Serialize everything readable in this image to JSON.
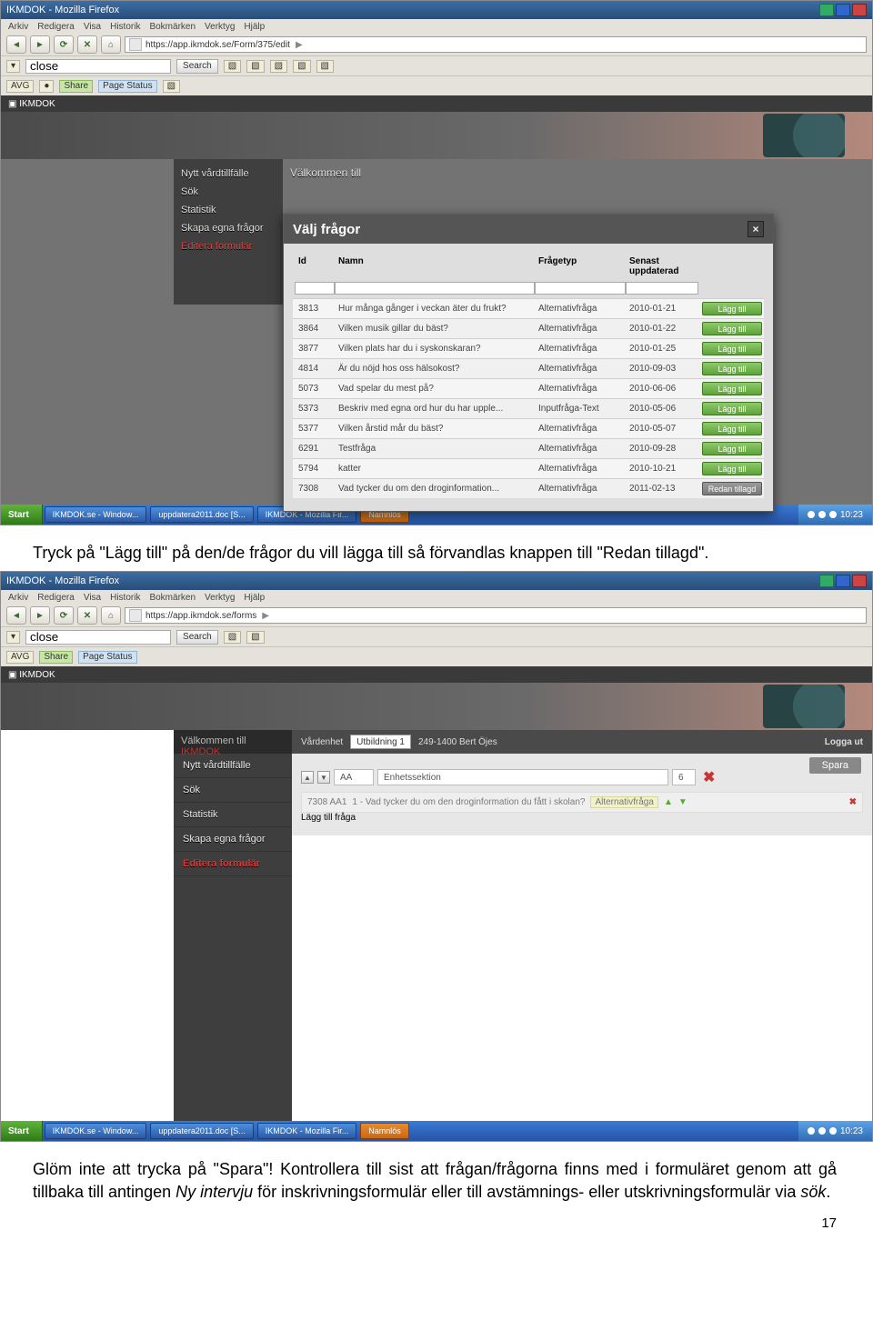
{
  "browser": {
    "title": "IKMDOK - Mozilla Firefox",
    "menu": [
      "Arkiv",
      "Redigera",
      "Visa",
      "Historik",
      "Bokmärken",
      "Verktyg",
      "Hjälp"
    ],
    "url1": "https://app.ikmdok.se/Form/375/edit",
    "url2": "https://app.ikmdok.se/forms",
    "search_placeholder": "close",
    "search_btn": "Search",
    "toolbar_labels": {
      "avg": "AVG",
      "pin": "",
      "share": "Share",
      "pagestatus": "Page Status"
    }
  },
  "app1": {
    "welcome_prefix": "Välkommen till",
    "sidebar": [
      "Nytt vårdtillfälle",
      "Sök",
      "Statistik",
      "Skapa egna frågor",
      "Editera formulär"
    ],
    "dialog_title": "Välj frågor",
    "columns": {
      "id": "Id",
      "name": "Namn",
      "type": "Frågetyp",
      "date": "Senast uppdaterad"
    },
    "add_label": "Lägg till",
    "added_label": "Redan tillagd",
    "rows": [
      {
        "id": "3813",
        "name": "Hur många gånger i veckan äter du frukt?",
        "type": "Alternativfråga",
        "date": "2010-01-21",
        "added": false
      },
      {
        "id": "3864",
        "name": "Vilken musik gillar du bäst?",
        "type": "Alternativfråga",
        "date": "2010-01-22",
        "added": false
      },
      {
        "id": "3877",
        "name": "Vilken plats har du i syskonskaran?",
        "type": "Alternativfråga",
        "date": "2010-01-25",
        "added": false
      },
      {
        "id": "4814",
        "name": "Är du nöjd hos oss hälsokost?",
        "type": "Alternativfråga",
        "date": "2010-09-03",
        "added": false
      },
      {
        "id": "5073",
        "name": "Vad spelar du mest på?",
        "type": "Alternativfråga",
        "date": "2010-06-06",
        "added": false
      },
      {
        "id": "5373",
        "name": "Beskriv med egna ord hur du har upple...",
        "type": "Inputfråga-Text",
        "date": "2010-05-06",
        "added": false
      },
      {
        "id": "5377",
        "name": "Vilken årstid mår du bäst?",
        "type": "Alternativfråga",
        "date": "2010-05-07",
        "added": false
      },
      {
        "id": "6291",
        "name": "Testfråga",
        "type": "Alternativfråga",
        "date": "2010-09-28",
        "added": false
      },
      {
        "id": "5794",
        "name": "katter",
        "type": "Alternativfråga",
        "date": "2010-10-21",
        "added": false
      },
      {
        "id": "7308",
        "name": "Vad tycker du om den droginformation...",
        "type": "Alternativfråga",
        "date": "2011-02-13",
        "added": true
      }
    ]
  },
  "taskbar": {
    "start": "Start",
    "items": [
      "IKMDOK.se - Window...",
      "uppdatera2011.doc [S...",
      "IKMDOK - Mozilla Fir...",
      "Namnlös"
    ],
    "time": "10:23"
  },
  "para1_a": "Tryck på ",
  "para1_b": "Lägg till",
  "para1_c": " på den/de frågor du vill lägga till så förvandlas knappen till ",
  "para1_d": "Redan tillagd",
  "para1_e": ".",
  "app2": {
    "welcome_prefix": "Välkommen till",
    "welcome_brand": "IKMDOK",
    "header_items": {
      "vardkedja": "Vårdenhet",
      "utbildning": "Utbildning 1",
      "user": "249-1400 Bert Öjes"
    },
    "logout": "Logga ut",
    "save": "Spara",
    "sidebar": [
      "Nytt vårdtillfälle",
      "Sök",
      "Statistik",
      "Skapa egna frågor",
      "Editera formulär"
    ],
    "row1": {
      "code": "AA",
      "title": "Enhetssektion",
      "count": "6"
    },
    "row2": {
      "code": "7308 AA1",
      "text": "1 - Vad tycker du om den droginformation du fått i skolan?",
      "tag": "Alternativfråga"
    },
    "add_more": "Lägg till fråga"
  },
  "para2_a": "Glöm inte att trycka på ",
  "para2_b": "Spara",
  "para2_c": "! Kontrollera till sist att frågan/frågorna finns med i formuläret genom att gå tillbaka till antingen ",
  "para2_d": "Ny intervju",
  "para2_e": " för inskrivningsformulär eller till avstämnings- eller utskrivningsformulär via ",
  "para2_f": "sök",
  "para2_g": ".",
  "page_number": "17"
}
